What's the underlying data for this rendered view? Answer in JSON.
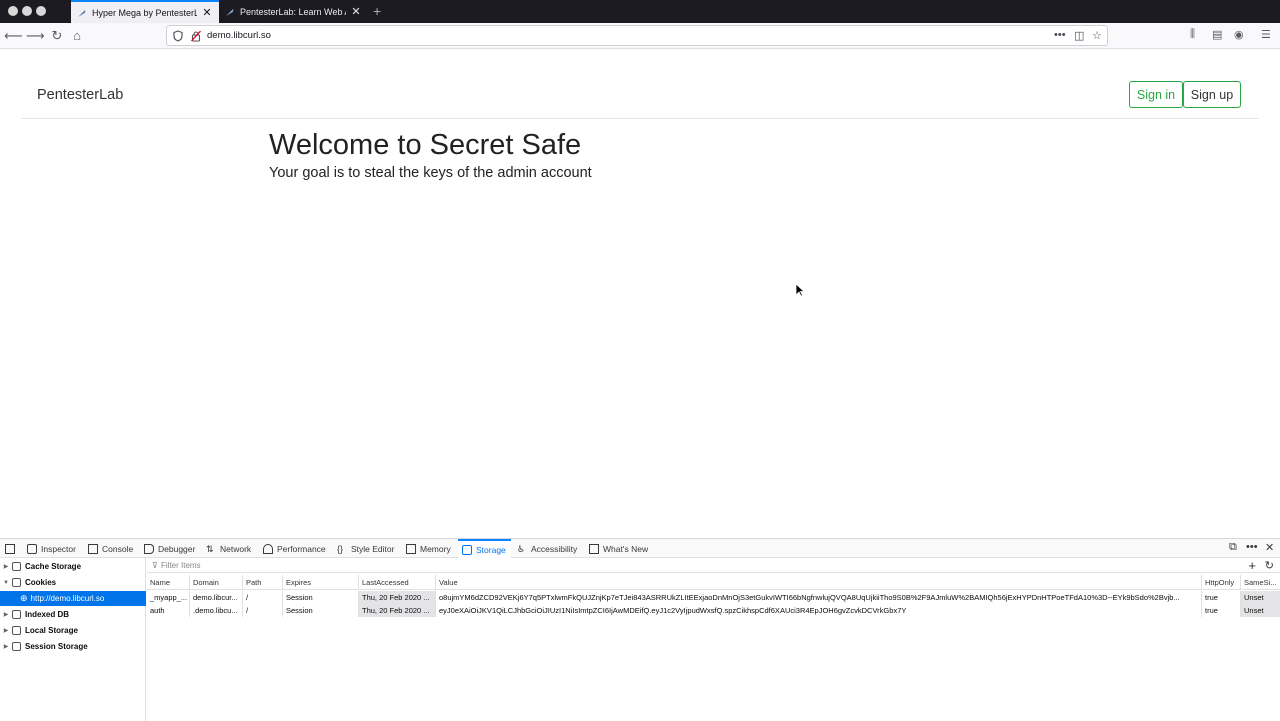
{
  "browser": {
    "tabs": [
      {
        "title": "Hyper Mega by PentesterLab: S",
        "active": true
      },
      {
        "title": "PentesterLab: Learn Web App P",
        "active": false
      }
    ],
    "url_prefix": "demo.",
    "url_domain": "libcurl.so"
  },
  "page": {
    "brand": "PentesterLab",
    "signin": "Sign in",
    "signup": "Sign up",
    "heading": "Welcome to Secret Safe",
    "subheading": "Your goal is to steal the keys of the admin account"
  },
  "devtools": {
    "tabs": [
      "Inspector",
      "Console",
      "Debugger",
      "Network",
      "Performance",
      "Style Editor",
      "Memory",
      "Storage",
      "Accessibility",
      "What's New"
    ],
    "active_tab": "Storage",
    "sidebar": [
      {
        "label": "Cache Storage",
        "expanded": false
      },
      {
        "label": "Cookies",
        "expanded": true
      },
      {
        "label": "http://demo.libcurl.so",
        "selected": true
      },
      {
        "label": "Indexed DB",
        "expanded": false
      },
      {
        "label": "Local Storage",
        "expanded": false
      },
      {
        "label": "Session Storage",
        "expanded": false
      }
    ],
    "filter_placeholder": "Filter Items",
    "columns": [
      "Name",
      "Domain",
      "Path",
      "Expires",
      "LastAccessed",
      "Value",
      "HttpOnly",
      "SameSi..."
    ],
    "rows": [
      [
        "_myapp_...",
        "demo.libcur...",
        "/",
        "Session",
        "Thu, 20 Feb 2020 ...",
        "o8ujmYM6dZCD92VEKj6Y7q5PTxlwmFkQUJZnjKp7eTJei843ASRRUkZLItEExjaoDnMnOjS3etGukvIWTI66bNgfnwlujQVQA8UqUjkiiTho9S0B%2F9AJmluW%2BAMIQh56jExHYPDnHTPoeTFdA10%3D--EYk9bSdo%2Bvjb...",
        "true",
        "Unset"
      ],
      [
        "auth",
        ".demo.libcu...",
        "/",
        "Session",
        "Thu, 20 Feb 2020 ...",
        "eyJ0eXAiOiJKV1QiLCJhbGciOiJIUzI1NiIsImtpZCI6IjAwMDEifQ.eyJ1c2VyIjpudWxsfQ.spzCikhspCdf6XAUci3R4EpJOH6gvZcvkDCVrkGbx7Y",
        "true",
        "Unset"
      ]
    ]
  }
}
